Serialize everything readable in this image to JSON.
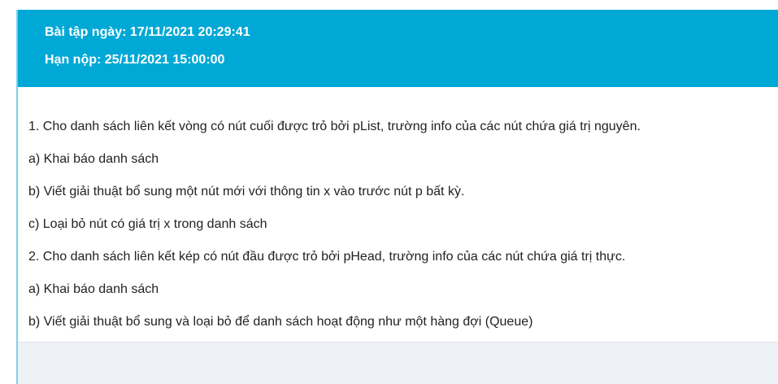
{
  "assignment": {
    "assigned_label": "Bài tập ngày: 17/11/2021 20:29:41",
    "due_label": "Hạn nộp: 25/11/2021 15:00:00"
  },
  "content": {
    "paragraphs": [
      "1. Cho danh sách liên kết vòng có nút cuối được trỏ bởi pList, trường info của các nút chứa giá trị nguyên.",
      "a) Khai báo danh sách",
      "b) Viết giải thuật bổ sung một nút mới với thông tin x vào trước nút p bất kỳ.",
      "c) Loại bỏ nút có giá trị x trong danh sách",
      "2. Cho danh sách liên kết kép có nút đầu được trỏ bởi pHead, trường info của các nút chứa giá trị thực.",
      "a) Khai báo danh sách",
      "b) Viết giải thuật bổ sung và loại bỏ để danh sách hoạt động như một hàng đợi (Queue)"
    ]
  },
  "colors": {
    "header_bg": "#00a8d6",
    "card_bg": "#eef1f5"
  }
}
